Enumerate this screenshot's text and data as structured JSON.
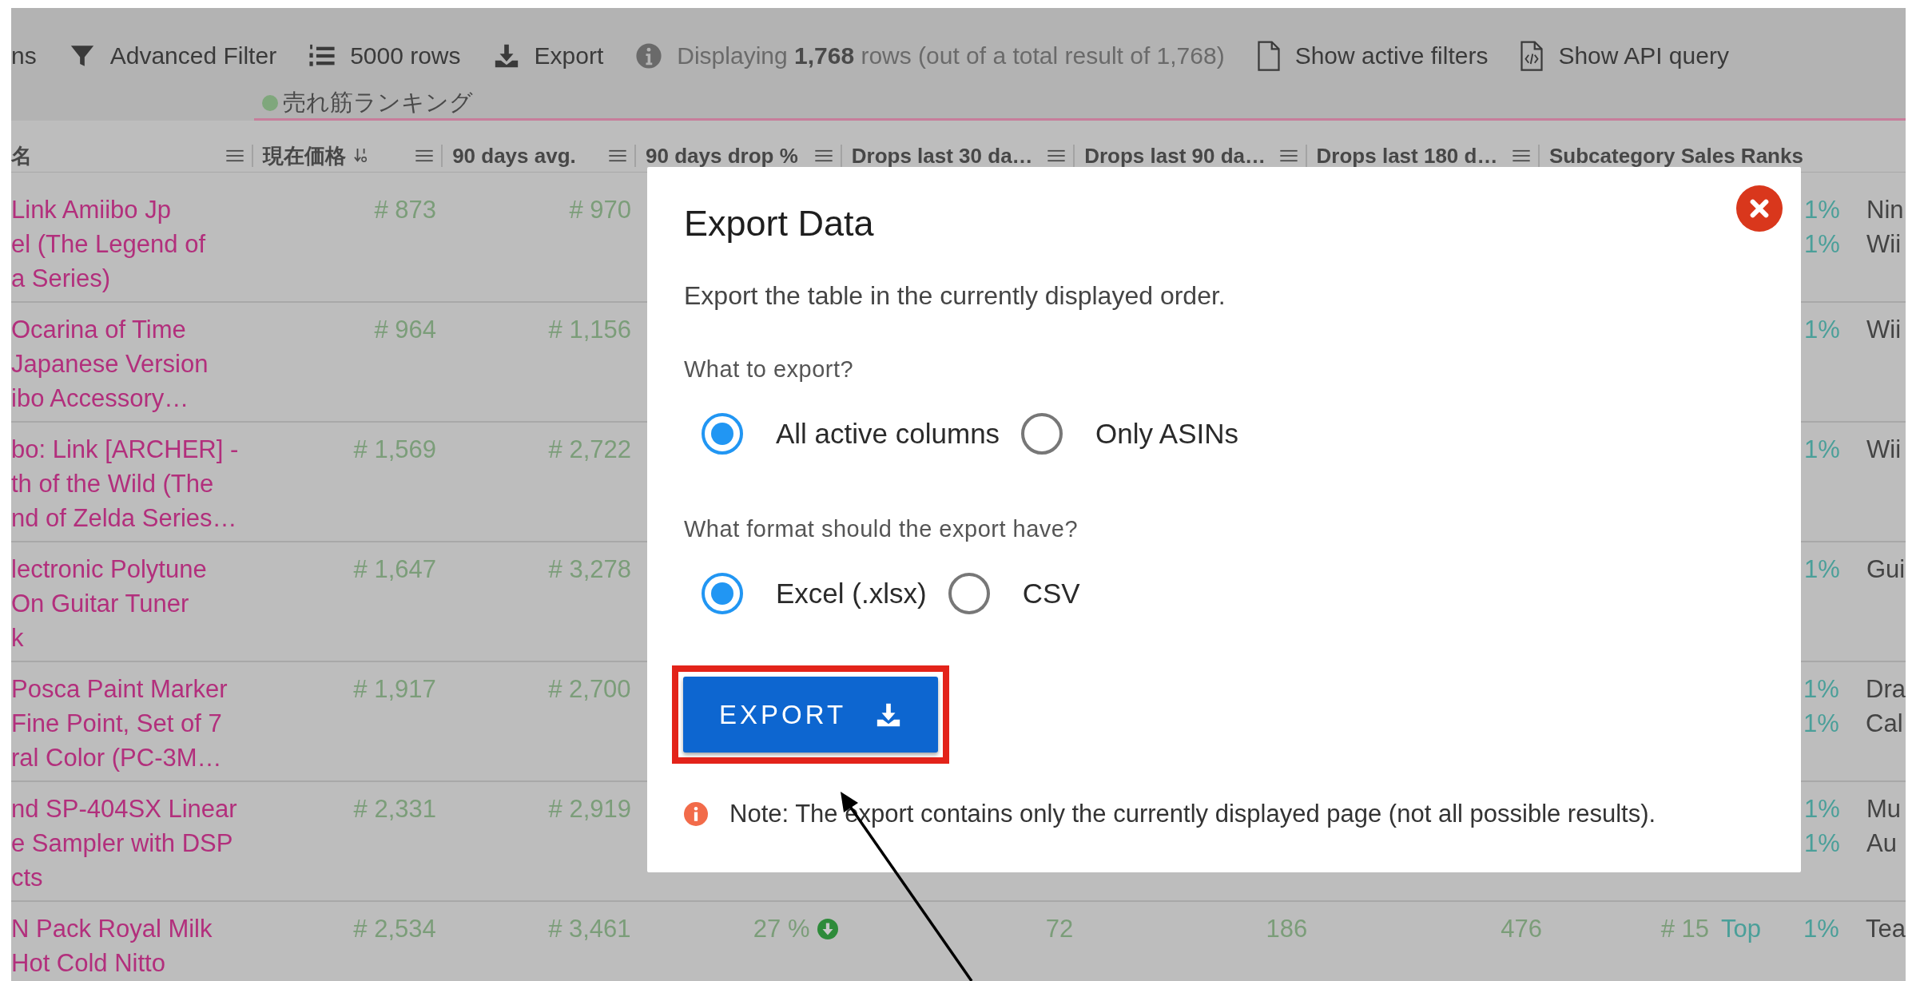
{
  "toolbar": {
    "items": [
      {
        "kind": "text",
        "label": "ns"
      },
      {
        "kind": "filter",
        "label": "Advanced Filter"
      },
      {
        "kind": "rows",
        "label": "5000 rows"
      },
      {
        "kind": "export",
        "label": "Export"
      },
      {
        "kind": "info",
        "label": "Displaying **1,768** rows (out of a total result of 1,768)"
      },
      {
        "kind": "file",
        "label": "Show active filters"
      },
      {
        "kind": "code",
        "label": "Show API query"
      }
    ]
  },
  "view_tab": {
    "label": "売れ筋ランキング"
  },
  "table": {
    "columns": [
      {
        "label": "名",
        "menu": true
      },
      {
        "label": "現在価格",
        "sorted": true,
        "menu": true
      },
      {
        "label": "90 days avg.",
        "menu": true
      },
      {
        "label": "90 days drop %",
        "menu": true
      },
      {
        "label": "Drops last 30 da…",
        "menu": true
      },
      {
        "label": "Drops last 90 da…",
        "menu": true
      },
      {
        "label": "Drops last 180 d…",
        "menu": true
      },
      {
        "label": "Subcategory Sales Ranks",
        "menu": false
      }
    ],
    "rows": [
      {
        "name_lines": [
          "Link Amiibo Jp",
          "el (The Legend of",
          "a Series)"
        ],
        "current_price": "# 873",
        "avg_90_days": "# 970",
        "rank_shares": [
          "1%",
          "1%"
        ],
        "subcategories": [
          "Nin",
          "Wii"
        ]
      },
      {
        "name_lines": [
          "Ocarina of Time",
          "Japanese Version",
          "ibo Accessory…"
        ],
        "current_price": "# 964",
        "avg_90_days": "# 1,156",
        "rank_shares": [
          "1%"
        ],
        "subcategories": [
          "Wii"
        ]
      },
      {
        "name_lines": [
          "bo: Link [ARCHER] -",
          "th of the Wild (The",
          "nd of Zelda Series…"
        ],
        "current_price": "# 1,569",
        "avg_90_days": "# 2,722",
        "rank_shares": [
          "1%"
        ],
        "subcategories": [
          "Wii"
        ]
      },
      {
        "name_lines": [
          "lectronic Polytune",
          "On Guitar Tuner",
          "k"
        ],
        "current_price": "# 1,647",
        "avg_90_days": "# 3,278",
        "rank_shares": [
          "1%"
        ],
        "subcategories": [
          "Gui"
        ]
      },
      {
        "name_lines": [
          "Posca Paint Marker",
          "Fine Point, Set of 7",
          "ral Color (PC-3M…"
        ],
        "current_price": "# 1,917",
        "avg_90_days": "# 2,700",
        "rank_shares": [
          "1%",
          "1%"
        ],
        "subcategories": [
          "Dra",
          "Cal"
        ]
      },
      {
        "name_lines": [
          "nd SP-404SX Linear",
          "e Sampler with DSP",
          "cts"
        ],
        "current_price": "# 2,331",
        "avg_90_days": "# 2,919",
        "rank_shares": [
          "1%",
          "1%"
        ],
        "subcategories": [
          "Mu",
          "Au"
        ]
      },
      {
        "name_lines": [
          "N Pack Royal Milk",
          "Hot Cold Nitto"
        ],
        "current_price": "# 2,534",
        "avg_90_days": "# 3,461",
        "drop_90_days": "27 %",
        "dropping": true,
        "drops_30_days": "72",
        "drops_90_days": "186",
        "drops_180_days": "476",
        "subcategory_rank": "# 15",
        "subcategory_badge": "Top",
        "rank_shares": [
          "1%"
        ],
        "subcategories": [
          "Tea"
        ]
      }
    ]
  },
  "dialog": {
    "title": "Export Data",
    "description": "Export the table in the currently displayed order.",
    "groups": [
      {
        "label": "What to export?",
        "options": [
          {
            "label": "All active columns",
            "selected": true
          },
          {
            "label": "Only ASINs",
            "selected": false
          }
        ]
      },
      {
        "label": "What format should the export have?",
        "options": [
          {
            "label": "Excel (.xlsx)",
            "selected": true
          },
          {
            "label": "CSV",
            "selected": false
          }
        ]
      }
    ],
    "button": {
      "label": "EXPORT",
      "highlighted": true
    },
    "note": "Note: The export contains only the currently displayed page (not all possible results)."
  }
}
